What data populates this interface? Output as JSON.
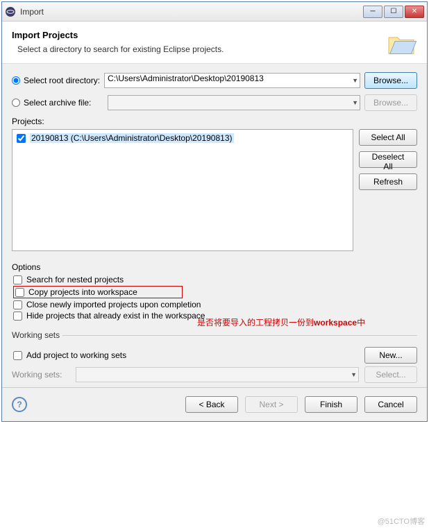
{
  "window": {
    "title": "Import"
  },
  "header": {
    "title": "Import Projects",
    "subtitle": "Select a directory to search for existing Eclipse projects."
  },
  "source": {
    "root_label": "Select root directory:",
    "root_value": "C:\\Users\\Administrator\\Desktop\\20190813",
    "archive_label": "Select archive file:",
    "archive_value": "",
    "browse": "Browse..."
  },
  "projects": {
    "label": "Projects:",
    "items": [
      {
        "checked": true,
        "text": "20190813 (C:\\Users\\Administrator\\Desktop\\20190813)"
      }
    ],
    "select_all": "Select All",
    "deselect_all": "Deselect All",
    "refresh": "Refresh"
  },
  "options": {
    "legend": "Options",
    "nested": "Search for nested projects",
    "copy": "Copy projects into workspace",
    "close": "Close newly imported projects upon completion",
    "hide": "Hide projects that already exist in the workspace"
  },
  "annotation": {
    "prefix": "是否将要导入的工程拷贝一份到",
    "bold": "workspace",
    "suffix": "中"
  },
  "working_sets": {
    "legend": "Working sets",
    "add": "Add project to working sets",
    "new": "New...",
    "label": "Working sets:",
    "select": "Select..."
  },
  "footer": {
    "back": "< Back",
    "next": "Next >",
    "finish": "Finish",
    "cancel": "Cancel"
  },
  "watermark": "@51CTO博客"
}
